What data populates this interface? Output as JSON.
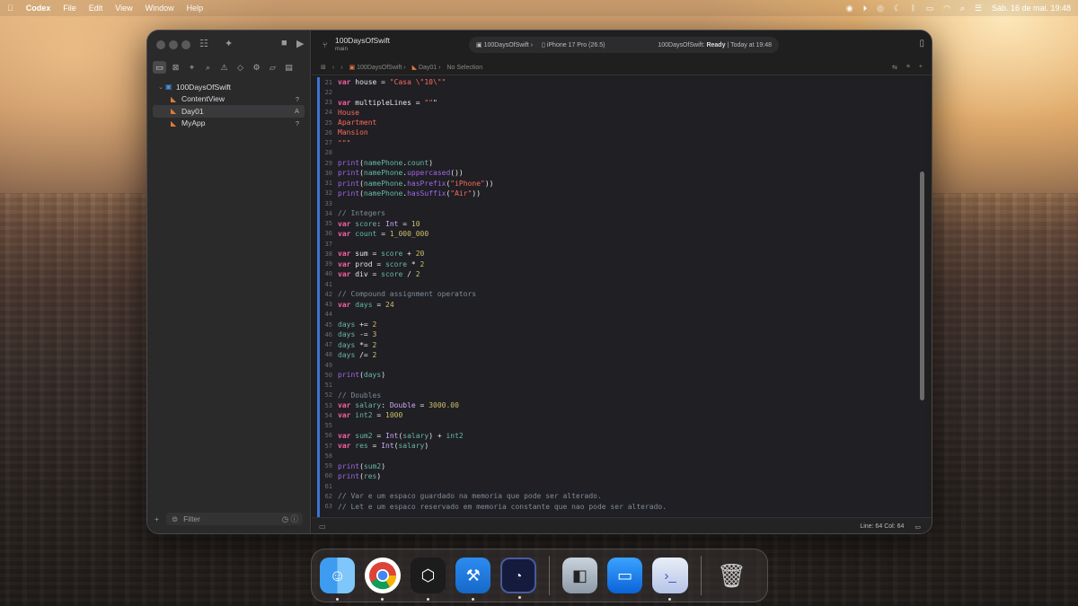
{
  "menubar": {
    "apple": "",
    "app": "Codex",
    "items": [
      "File",
      "Edit",
      "View",
      "Window",
      "Help"
    ],
    "clock": "Sáb. 16 de mai.  19:48"
  },
  "window": {
    "project_name": "100DaysOfSwift",
    "branch": "main",
    "scheme": "100DaysOfSwift",
    "device": "iPhone 17 Pro (26.5)",
    "status_project": "100DaysOfSwift:",
    "status_state": "Ready",
    "status_time": "Today at 19:48"
  },
  "navigator": {
    "root": "100DaysOfSwift",
    "files": [
      {
        "name": "ContentView",
        "badge": "?"
      },
      {
        "name": "Day01",
        "badge": "A"
      },
      {
        "name": "MyApp",
        "badge": "?"
      }
    ],
    "filter_placeholder": "Filter",
    "add_label": "+"
  },
  "jumpbar": {
    "project": "100DaysOfSwift",
    "file": "Day01",
    "selection": "No Selection"
  },
  "status_bar": {
    "line": "Line: 64",
    "col": "Col: 64"
  },
  "code_lines": [
    {
      "n": "21",
      "t": "var house = \"Casa \\\"10\\\"\""
    },
    {
      "n": "22",
      "t": ""
    },
    {
      "n": "23",
      "t": "var multipleLines = \"\"\""
    },
    {
      "n": "24",
      "t": "House"
    },
    {
      "n": "25",
      "t": "Apartment"
    },
    {
      "n": "26",
      "t": "Mansion"
    },
    {
      "n": "27",
      "t": "\"\"\""
    },
    {
      "n": "28",
      "t": ""
    },
    {
      "n": "29",
      "t": "print(namePhone.count)"
    },
    {
      "n": "30",
      "t": "print(namePhone.uppercased())"
    },
    {
      "n": "31",
      "t": "print(namePhone.hasPrefix(\"iPhone\"))"
    },
    {
      "n": "32",
      "t": "print(namePhone.hasSuffix(\"Air\"))"
    },
    {
      "n": "33",
      "t": ""
    },
    {
      "n": "34",
      "t": "// Integers"
    },
    {
      "n": "35",
      "t": "var score: Int = 10"
    },
    {
      "n": "36",
      "t": "var count = 1_000_000"
    },
    {
      "n": "37",
      "t": ""
    },
    {
      "n": "38",
      "t": "var sum = score + 20"
    },
    {
      "n": "39",
      "t": "var prod = score * 2"
    },
    {
      "n": "40",
      "t": "var div = score / 2"
    },
    {
      "n": "41",
      "t": ""
    },
    {
      "n": "42",
      "t": "// Compound assignment operators"
    },
    {
      "n": "43",
      "t": "var days = 24"
    },
    {
      "n": "44",
      "t": ""
    },
    {
      "n": "45",
      "t": "days += 2"
    },
    {
      "n": "46",
      "t": "days -= 3"
    },
    {
      "n": "47",
      "t": "days *= 2"
    },
    {
      "n": "48",
      "t": "days /= 2"
    },
    {
      "n": "49",
      "t": ""
    },
    {
      "n": "50",
      "t": "print(days)"
    },
    {
      "n": "51",
      "t": ""
    },
    {
      "n": "52",
      "t": "// Doubles"
    },
    {
      "n": "53",
      "t": "var salary: Double = 3000.00"
    },
    {
      "n": "54",
      "t": "var int2 = 1000"
    },
    {
      "n": "55",
      "t": ""
    },
    {
      "n": "56",
      "t": "var sum2 = Int(salary) + int2"
    },
    {
      "n": "57",
      "t": "var res = Int(salary)"
    },
    {
      "n": "58",
      "t": ""
    },
    {
      "n": "59",
      "t": "print(sum2)"
    },
    {
      "n": "60",
      "t": "print(res)"
    },
    {
      "n": "61",
      "t": ""
    },
    {
      "n": "62",
      "t": "// Var e um espaco guardado na memoria que pode ser alterado."
    },
    {
      "n": "63",
      "t": "// Let e um espaco reservado em memoria constante que nao pode ser alterado."
    }
  ],
  "dock": [
    {
      "name": "Finder",
      "icon": "finder-icon",
      "running": true
    },
    {
      "name": "Google Chrome",
      "icon": "chrome-icon",
      "running": true
    },
    {
      "name": "Cursor",
      "icon": "cursor-icon",
      "running": true
    },
    {
      "name": "Xcode",
      "icon": "xcode-icon",
      "running": true
    },
    {
      "name": "Codex",
      "icon": "codex-icon",
      "running": true
    },
    {
      "name": "App",
      "icon": "app-icon",
      "running": false
    },
    {
      "name": "Simulator",
      "icon": "simulator-icon",
      "running": false
    },
    {
      "name": "Terminal",
      "icon": "terminal-icon",
      "running": true
    },
    {
      "name": "Trash",
      "icon": "trash-icon",
      "running": false
    }
  ]
}
